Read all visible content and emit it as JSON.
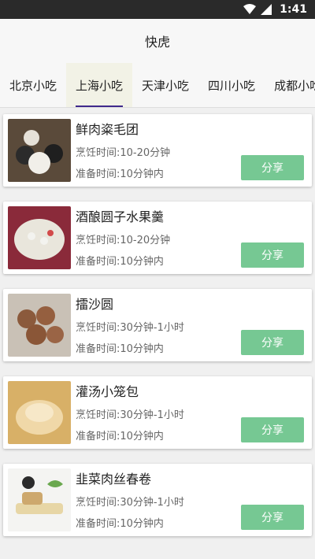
{
  "status": {
    "time": "1:41"
  },
  "appbar": {
    "title": "快虎"
  },
  "tabs": [
    {
      "label": "北京小吃"
    },
    {
      "label": "上海小吃",
      "active": true
    },
    {
      "label": "天津小吃"
    },
    {
      "label": "四川小吃"
    },
    {
      "label": "成都小吃"
    }
  ],
  "items": [
    {
      "title": "鲜肉粢毛团",
      "cook": "烹饪时间:10-20分钟",
      "prep": "准备时间:10分钟内",
      "share": "分享"
    },
    {
      "title": "酒酿圆子水果羹",
      "cook": "烹饪时间:10-20分钟",
      "prep": "准备时间:10分钟内",
      "share": "分享"
    },
    {
      "title": "擂沙圆",
      "cook": "烹饪时间:30分钟-1小时",
      "prep": "准备时间:10分钟内",
      "share": "分享"
    },
    {
      "title": "灌汤小笼包",
      "cook": "烹饪时间:30分钟-1小时",
      "prep": "准备时间:10分钟内",
      "share": "分享"
    },
    {
      "title": "韭菜肉丝春卷",
      "cook": "烹饪时间:30分钟-1小时",
      "prep": "准备时间:10分钟内",
      "share": "分享"
    }
  ]
}
